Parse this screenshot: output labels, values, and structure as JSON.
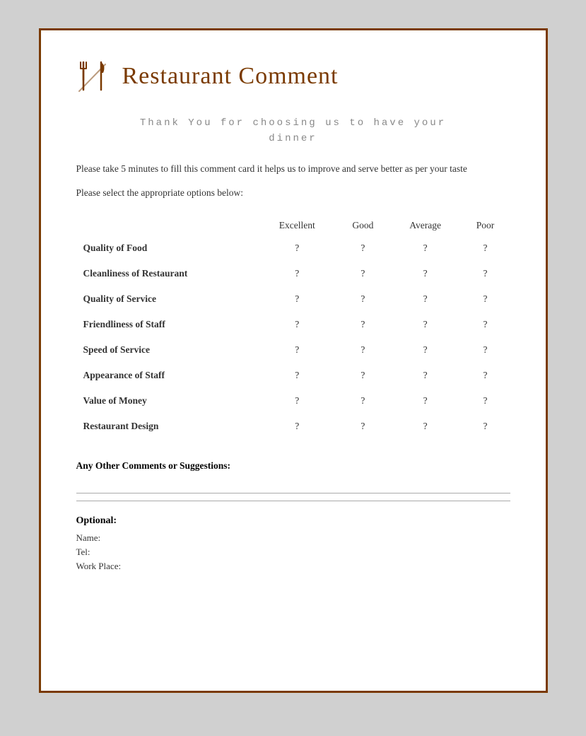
{
  "header": {
    "title": "Restaurant Comment"
  },
  "thank_you": {
    "line1": "Thank You for choosing us to have your",
    "line2": "dinner"
  },
  "description": "Please take 5 minutes to fill this comment card it helps us to improve and serve better as per your taste",
  "instruction": "Please select the appropriate options below:",
  "table": {
    "columns": [
      "",
      "Excellent",
      "Good",
      "Average",
      "Poor"
    ],
    "rows": [
      {
        "label": "Quality of Food",
        "excellent": "?",
        "good": "?",
        "average": "?",
        "poor": "?"
      },
      {
        "label": "Cleanliness of Restaurant",
        "excellent": "?",
        "good": "?",
        "average": "?",
        "poor": "?"
      },
      {
        "label": "Quality of Service",
        "excellent": "?",
        "good": "?",
        "average": "?",
        "poor": "?"
      },
      {
        "label": "Friendliness of Staff",
        "excellent": "?",
        "good": "?",
        "average": "?",
        "poor": "?"
      },
      {
        "label": "Speed of Service",
        "excellent": "?",
        "good": "?",
        "average": "?",
        "poor": "?"
      },
      {
        "label": "Appearance of Staff",
        "excellent": "?",
        "good": "?",
        "average": "?",
        "poor": "?"
      },
      {
        "label": "Value of Money",
        "excellent": "?",
        "good": "?",
        "average": "?",
        "poor": "?"
      },
      {
        "label": "Restaurant Design",
        "excellent": "?",
        "good": "?",
        "average": "?",
        "poor": "?"
      }
    ]
  },
  "comments": {
    "label": "Any Other Comments or Suggestions:"
  },
  "optional": {
    "title": "Optional:",
    "fields": [
      "Name:",
      "Tel:",
      "Work Place:"
    ]
  }
}
